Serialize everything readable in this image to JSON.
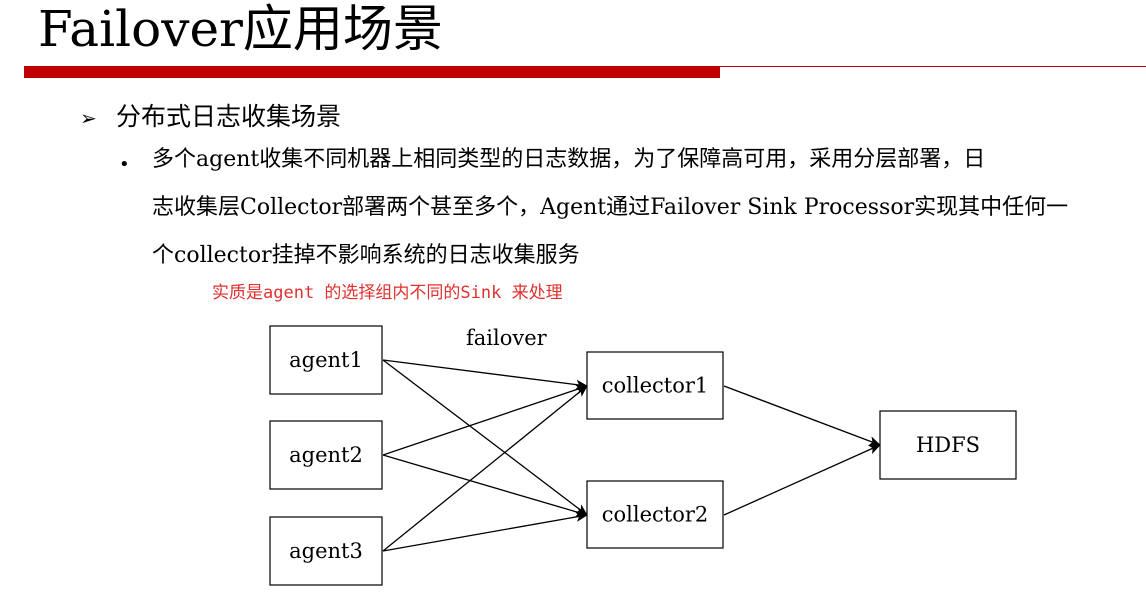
{
  "title": "Failover应用场景",
  "colors": {
    "accent": "#c00000",
    "note": "#e03030"
  },
  "bullet_marker": "➢",
  "section": "分布式日志收集场景",
  "sub_bullet_marker": "•",
  "paragraph_lines": [
    "多个agent收集不同机器上相同类型的日志数据，为了保障高可用，采用分层部署，日",
    "志收集层Collector部署两个甚至多个，Agent通过Failover Sink Processor实现其中任何一",
    "个collector挂掉不影响系统的日志收集服务"
  ],
  "note": "实质是agent 的选择组内不同的Sink 来处理",
  "diagram": {
    "edge_label": "failover",
    "nodes": {
      "agent1": "agent1",
      "agent2": "agent2",
      "agent3": "agent3",
      "collector1": "collector1",
      "collector2": "collector2",
      "hdfs": "HDFS"
    },
    "edges": [
      [
        "agent1",
        "collector1"
      ],
      [
        "agent1",
        "collector2"
      ],
      [
        "agent2",
        "collector1"
      ],
      [
        "agent2",
        "collector2"
      ],
      [
        "agent3",
        "collector1"
      ],
      [
        "agent3",
        "collector2"
      ],
      [
        "collector1",
        "hdfs"
      ],
      [
        "collector2",
        "hdfs"
      ]
    ]
  }
}
